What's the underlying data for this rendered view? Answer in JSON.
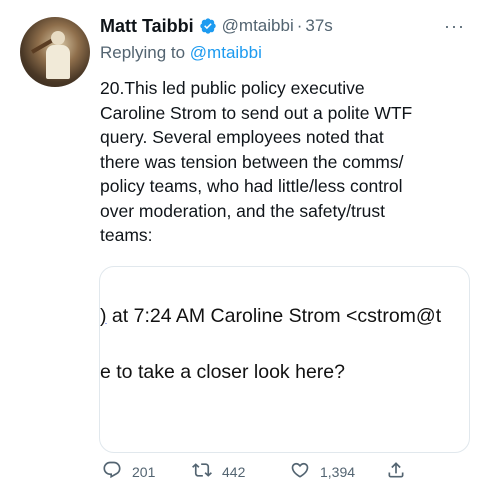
{
  "tweet": {
    "author_name": "Matt Taibbi",
    "handle": "@mtaibbi",
    "separator": "·",
    "timestamp": "37s",
    "more_icon": "more-horizontal-icon",
    "more_glyph": "···",
    "replying_prefix": "Replying to",
    "replying_mention": "@mtaibbi",
    "text_lines": [
      "20.This led public policy executive",
      "Caroline Strom to send out a polite WTF",
      "query. Several employees noted that",
      "there was tension between the comms/",
      "policy teams, who had little/less control",
      "over moderation, and the safety/trust",
      "teams:"
    ],
    "image": {
      "line1_prefix": ")",
      "line1_text": " at 7:24 AM Caroline Strom <cstrom@t",
      "line2_text": "e to take a closer look here?"
    },
    "actions": {
      "reply_count": "201",
      "retweet_count": "442",
      "like_count": "1,394"
    },
    "colors": {
      "accent": "#1d9bf0",
      "secondary_text": "#536471",
      "primary_text": "#0f1419"
    }
  }
}
